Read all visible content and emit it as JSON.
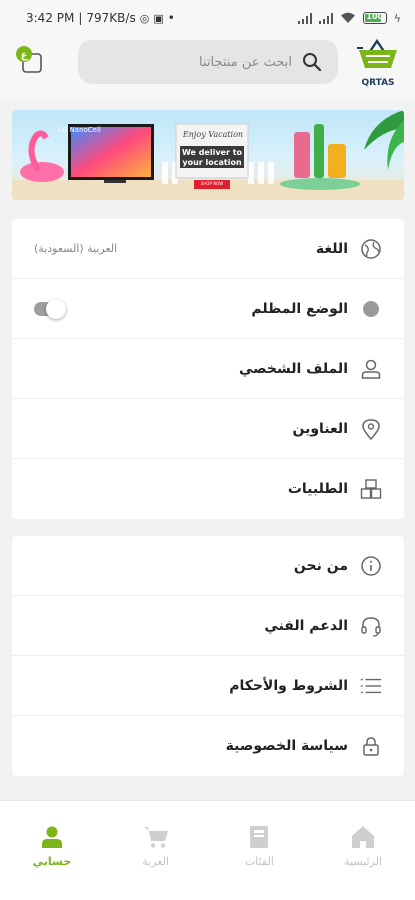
{
  "status_bar": {
    "time": "3:42 PM",
    "network_speed": "797KB/s",
    "battery": "100"
  },
  "header": {
    "search_placeholder": "ابحث عن منتجاتنا",
    "logo_text": "QRTAS"
  },
  "banner": {
    "tv_brand": "LG NanoCell",
    "tagline": "Enjoy Vacation",
    "headline_line1": "We deliver to",
    "headline_line2": "your location",
    "cta": "SHOP NOW"
  },
  "settings": {
    "items": [
      {
        "label": "اللغة",
        "value": "العربية (السعودية)",
        "icon": "globe-icon"
      },
      {
        "label": "الوضع المظلم",
        "icon": "moon-icon",
        "toggle": false
      },
      {
        "label": "الملف الشخصي",
        "icon": "user-icon"
      },
      {
        "label": "العناوين",
        "icon": "location-pin-icon"
      },
      {
        "label": "الطلبيات",
        "icon": "boxes-icon"
      }
    ]
  },
  "info": {
    "items": [
      {
        "label": "من نحن",
        "icon": "info-icon"
      },
      {
        "label": "الدعم الفني",
        "icon": "headset-icon"
      },
      {
        "label": "الشروط والأحكام",
        "icon": "list-icon"
      },
      {
        "label": "سياسة الخصوصية",
        "icon": "lock-icon"
      }
    ]
  },
  "bottom_nav": {
    "items": [
      {
        "label": "حسابي",
        "icon": "person-icon",
        "active": true
      },
      {
        "label": "العربة",
        "icon": "cart-icon",
        "active": false
      },
      {
        "label": "الفئات",
        "icon": "book-icon",
        "active": false
      },
      {
        "label": "الرئيسية",
        "icon": "home-icon",
        "active": false
      }
    ]
  },
  "colors": {
    "accent": "#7cb518",
    "background": "#f2f2f2",
    "card": "#ffffff",
    "inactive_nav": "#c4c4c4"
  }
}
